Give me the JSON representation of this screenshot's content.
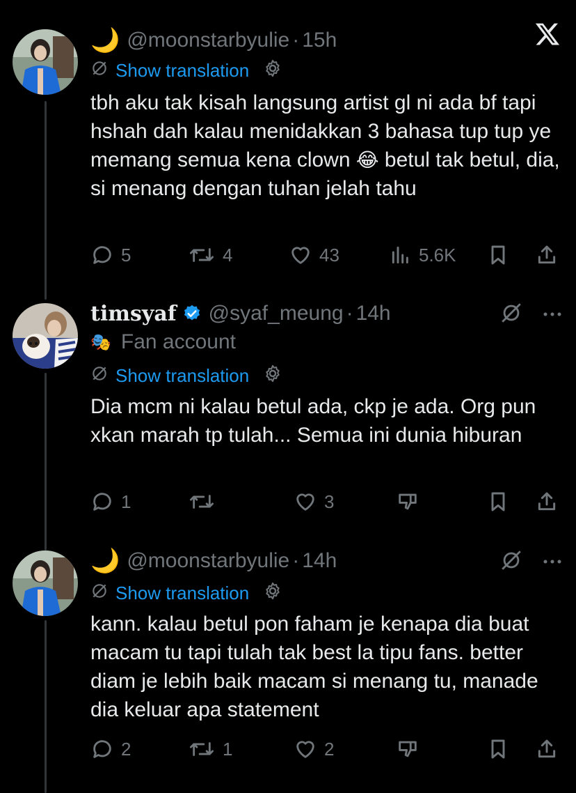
{
  "posts": [
    {
      "display_name": "",
      "emoji_prefix": "🌙",
      "handle": "@moonstarbyulie",
      "time": "15h",
      "translation_label": "Show translation",
      "text_parts": [
        "tbh aku tak kisah langsung artist gl ni ada bf tapi hshah dah kalau menidakkan 3 bahasa tup tup ye memang semua kena clown ",
        "😂",
        " betul tak betul, dia, si menang dengan tuhan jelah tahu"
      ],
      "replies": "5",
      "reposts": "4",
      "likes": "43",
      "views": "5.6K"
    },
    {
      "display_name": "timsyaf",
      "verified": true,
      "handle": "@syaf_meung",
      "time": "14h",
      "label_icon": "🎭",
      "label": "Fan account",
      "translation_label": "Show translation",
      "text": "Dia mcm ni kalau betul ada, ckp je ada. Org pun xkan marah tp tulah... Semua ini dunia hiburan",
      "replies": "1",
      "reposts": "",
      "likes": "3"
    },
    {
      "display_name": "",
      "emoji_prefix": "🌙",
      "handle": "@moonstarbyulie",
      "time": "14h",
      "translation_label": "Show translation",
      "text": "kann. kalau betul pon faham je kenapa dia buat macam tu tapi tulah tak best la tipu fans. better diam je lebih baik macam si menang tu, manade dia keluar apa statement",
      "replies": "2",
      "reposts": "1",
      "likes": "2"
    }
  ],
  "colors": {
    "background": "#000000",
    "text": "#e7e9ea",
    "muted": "#71767b",
    "link": "#1d9bf0",
    "verified": "#1d9bf0",
    "thread_line": "#333639"
  },
  "icons": [
    "x-logo-icon",
    "translate-icon",
    "gear-icon",
    "reply-icon",
    "repost-icon",
    "like-icon",
    "views-icon",
    "bookmark-icon",
    "share-icon",
    "grok-icon",
    "more-icon",
    "downvote-icon",
    "verified-icon",
    "mask-icon",
    "moon-icon"
  ]
}
